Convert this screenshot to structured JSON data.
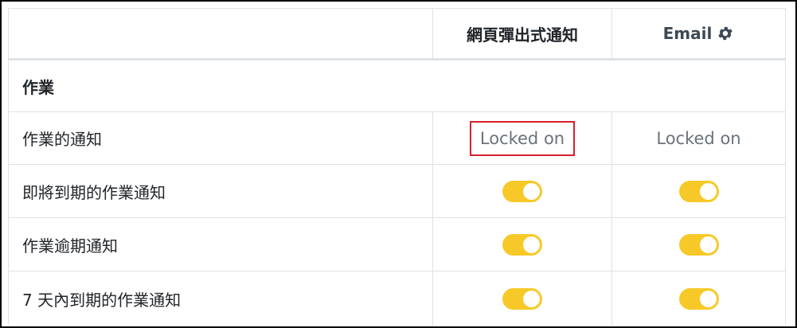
{
  "columns": {
    "web_popup": "網頁彈出式通知",
    "email": "Email",
    "email_icon": "gear-icon"
  },
  "section": {
    "title": "作業"
  },
  "rows": [
    {
      "label": "作業的通知",
      "web": "Locked on",
      "email": "Locked on"
    },
    {
      "label": "即將到期的作業通知",
      "web_toggle": true,
      "email_toggle": true
    },
    {
      "label": "作業逾期通知",
      "web_toggle": true,
      "email_toggle": true
    },
    {
      "label": "7 天內到期的作業通知",
      "web_toggle": true,
      "email_toggle": true
    }
  ],
  "colors": {
    "toggle_on": "#f7c928",
    "highlight_box": "#d9202c",
    "muted_text": "#6a737c"
  }
}
